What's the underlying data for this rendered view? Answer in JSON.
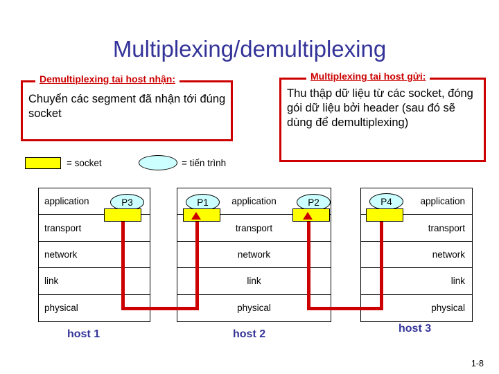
{
  "slide": {
    "title": "Multiplexing/demultiplexing",
    "number": "1-8"
  },
  "callouts": {
    "demux": {
      "heading": "Demultiplexing tai host nhận:",
      "body": "Chuyển các segment đã nhận tới đúng socket"
    },
    "mux": {
      "heading": "Multiplexing tai host gửi:",
      "body": "Thu thập dữ liệu từ các socket, đóng gói dữ liệu bởi header (sau đó sẽ dùng để demultiplexing)"
    }
  },
  "legend": {
    "socket_label": "= socket",
    "process_label": "= tiến trình",
    "socket_color": "#ffff00",
    "process_color": "#ccffff"
  },
  "hosts": [
    {
      "name": "host 1",
      "align": "align-left",
      "layers": [
        "application",
        "transport",
        "network",
        "link",
        "physical"
      ],
      "sockets": [
        {
          "process": "P3"
        }
      ]
    },
    {
      "name": "host 2",
      "align": "align-center",
      "layers": [
        "application",
        "transport",
        "network",
        "link",
        "physical"
      ],
      "sockets": [
        {
          "process": "P1"
        },
        {
          "process": "P2"
        }
      ]
    },
    {
      "name": "host 3",
      "align": "align-right",
      "layers": [
        "application",
        "transport",
        "network",
        "link",
        "physical"
      ],
      "sockets": [
        {
          "process": "P4"
        }
      ]
    }
  ],
  "colors": {
    "title": "#333399",
    "callout_border": "#cc0000",
    "callout_heading": "#cc0000",
    "connector": "#cc0000",
    "host_label": "#333399"
  }
}
